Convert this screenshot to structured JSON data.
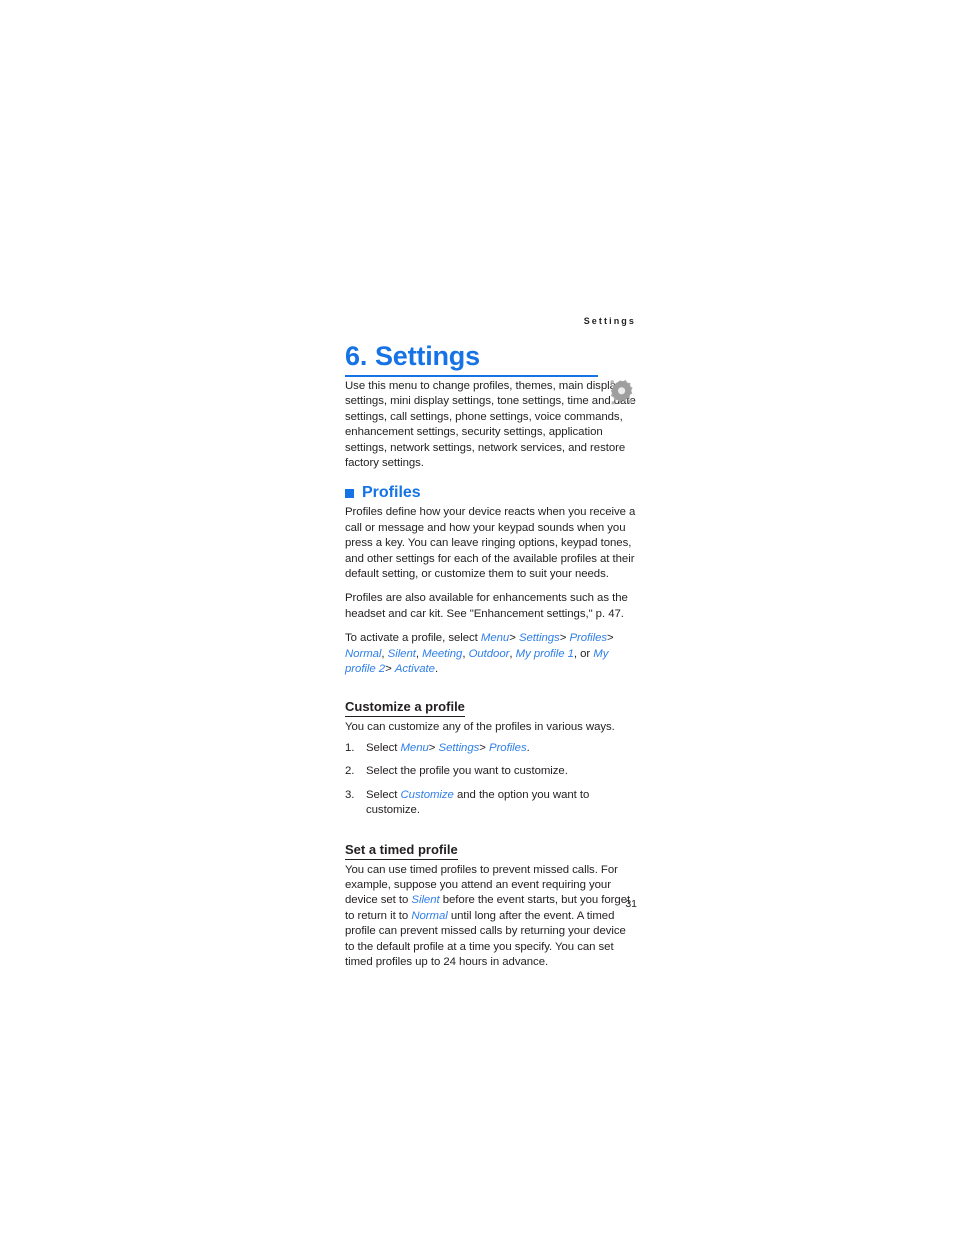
{
  "page": {
    "running_head": "Settings",
    "folio": "31"
  },
  "chapter": {
    "number": "6.",
    "title": "Settings",
    "icon": "gear-icon"
  },
  "intro": {
    "paragraph": "Use this menu to change profiles, themes, main display settings, mini display settings, tone settings, time and date settings, call settings, phone settings, voice commands, enhancement settings, security settings, application settings, network settings, network services, and restore factory settings."
  },
  "profiles_section": {
    "heading": "Profiles",
    "paragraph_1": "Profiles define how your device reacts when you receive a call or message and how your keypad sounds when you press a key. You can leave ringing options, keypad tones, and other settings for each of the available profiles at their default setting, or customize them to suit your needs.",
    "paragraph_2": "Profiles are also available for enhancements such as the headset and car kit. See \"Enhancement settings,\" p. 47.",
    "activate": {
      "lead": "To activate a profile, select",
      "path": [
        "Menu",
        "Settings",
        "Profiles"
      ],
      "separator": ">",
      "profiles": [
        "Normal",
        "Silent",
        "Meeting",
        "Outdoor",
        "My profile 1",
        "My profile 2"
      ],
      "or_label": ", or",
      "action": "Activate",
      "trailing_period": "."
    }
  },
  "customize_section": {
    "heading": "Customize a profile",
    "intro": "You can customize any of the profiles in various ways.",
    "steps": [
      {
        "number": "1.",
        "lead": "Select",
        "path": [
          "Menu",
          "Settings",
          "Profiles"
        ],
        "separator": ">",
        "trailing": "."
      },
      {
        "number": "2.",
        "text": "Select the profile you want to customize."
      },
      {
        "number": "3.",
        "lead": "Select",
        "link": "Customize",
        "trailing": "and the option you want to customize."
      }
    ]
  },
  "timed_section": {
    "heading": "Set a timed profile",
    "text_part_1": "You can use timed profiles to prevent missed calls. For example, suppose you attend an event requiring your device set to ",
    "link_1": "Silent",
    "text_part_2": " before the event starts, but you forget to return it to ",
    "link_2": "Normal",
    "text_part_3": " until long after the event. A timed profile can prevent missed calls by returning your device to the default profile at a time you specify. You can set timed profiles up to 24 hours in advance."
  },
  "colors": {
    "accent_blue": "#1673e6",
    "link_blue": "#2f7fe8",
    "text_black": "#231f20"
  }
}
